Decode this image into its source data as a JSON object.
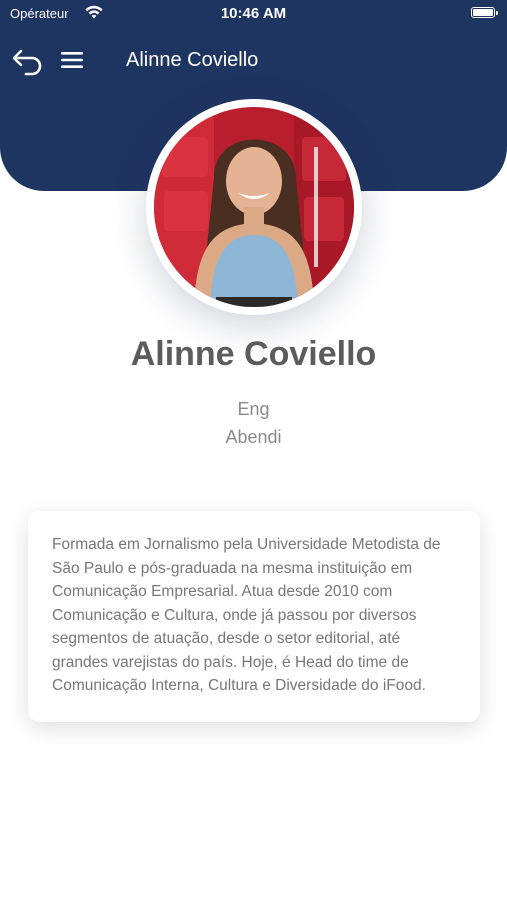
{
  "status_bar": {
    "carrier": "Opérateur",
    "time": "10:46 AM",
    "battery_level": 1.0
  },
  "header": {
    "title": "Alinne Coviello",
    "back_icon": "back-arrow-icon",
    "menu_icon": "hamburger-menu-icon",
    "background_color": "#1e3461"
  },
  "profile": {
    "name": "Alinne Coviello",
    "role": "Eng",
    "company": "Abendi"
  },
  "bio": {
    "text": "Formada em Jornalismo pela Universidade Metodista de São Paulo e pós-graduada na mesma instituição em Comunicação Empresarial. Atua desde 2010 com Comunicação e Cultura, onde já passou por diversos segmentos de atuação, desde o setor editorial, até grandes varejistas do país. Hoje, é Head do time de Comunicação Interna, Cultura e Diversidade do iFood."
  }
}
